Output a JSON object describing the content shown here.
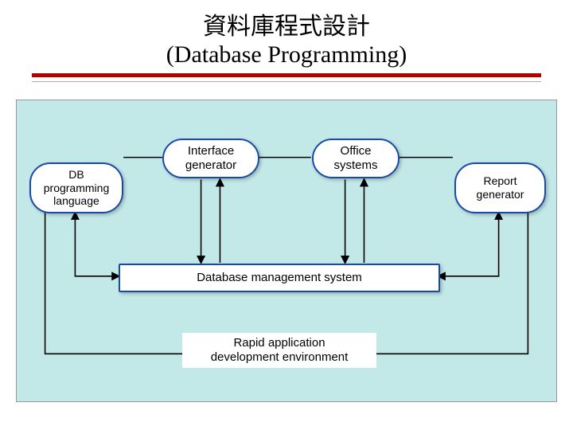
{
  "title": {
    "cn": "資料庫程式設計",
    "en": "(Database Programming)"
  },
  "nodes": {
    "db_lang": "DB\nprogramming\nlanguage",
    "iface": "Interface\ngenerator",
    "office": "Office\nsystems",
    "report": "Report\ngenerator",
    "dbms": "Database management system",
    "rad": "Rapid application\ndevelopment environment"
  }
}
